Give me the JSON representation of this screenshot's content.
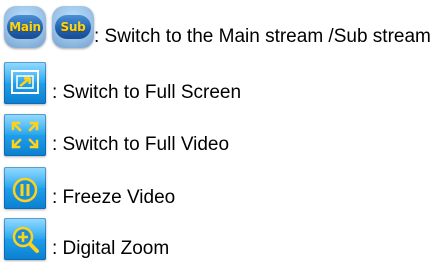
{
  "buttons": {
    "main_stream": {
      "icon_text": "Main",
      "icon": "main-stream-icon"
    },
    "sub_stream": {
      "icon_text": "Sub",
      "icon": "sub-stream-icon"
    },
    "full_screen": {
      "icon": "full-screen-icon"
    },
    "full_video": {
      "icon": "full-video-icon"
    },
    "freeze_video": {
      "icon": "freeze-video-icon"
    },
    "digital_zoom": {
      "icon": "digital-zoom-icon"
    }
  },
  "legend": {
    "stream_label": ": Switch to the Main stream /Sub stream",
    "full_screen_label": ": Switch to Full Screen",
    "full_video_label": ": Switch to Full Video",
    "freeze_label": ": Freeze Video",
    "zoom_label": ": Digital Zoom"
  },
  "colors": {
    "tile_blue": "#20a3ee",
    "pill_text": "#f7d51b"
  }
}
